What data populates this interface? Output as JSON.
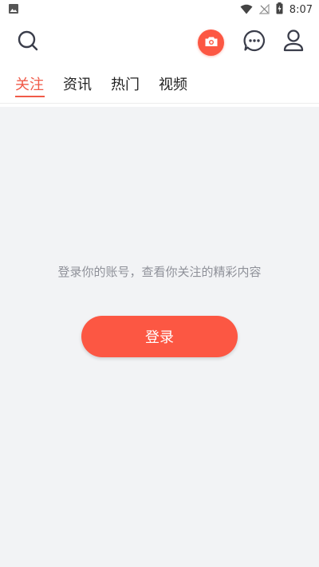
{
  "status_bar": {
    "time": "8:07",
    "icons": [
      "image-icon",
      "wifi-icon",
      "no-signal-icon",
      "battery-charging-icon"
    ]
  },
  "top_bar": {
    "icons": [
      "search-icon",
      "camera-icon",
      "message-icon",
      "user-icon"
    ],
    "accent_color": "#fc5743"
  },
  "tabs": [
    {
      "label": "关注",
      "active": true
    },
    {
      "label": "资讯",
      "active": false
    },
    {
      "label": "热门",
      "active": false
    },
    {
      "label": "视频",
      "active": false
    }
  ],
  "main": {
    "hint": "登录你的账号，查看你关注的精彩内容",
    "login_label": "登录"
  },
  "colors": {
    "accent": "#fc5743",
    "tab_active": "#f05a48",
    "content_background": "#f2f3f5",
    "hint_text": "#8f9199"
  }
}
